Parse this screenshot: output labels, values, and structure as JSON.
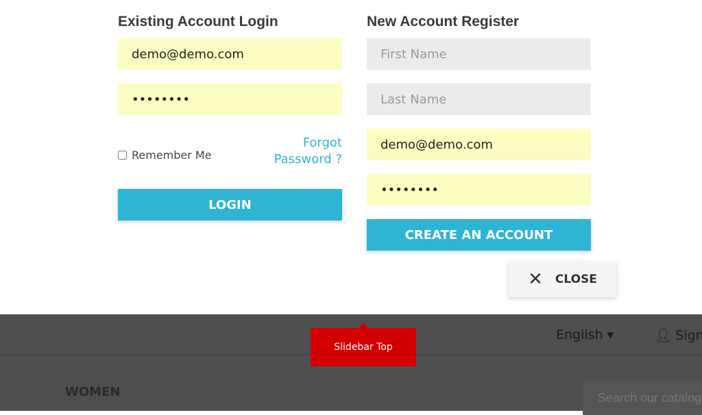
{
  "login": {
    "title": "Existing Account Login",
    "email": "demo@demo.com",
    "password": "demopass",
    "remember_label": "Remember Me",
    "forgot_label": "Forgot Password ?",
    "button": "LOGIN"
  },
  "register": {
    "title": "New Account Register",
    "first_name_placeholder": "First Name",
    "last_name_placeholder": "Last Name",
    "email": "demo@demo.com",
    "password": "demopass",
    "button": "CREATE AN ACCOUNT"
  },
  "close_label": "CLOSE",
  "header": {
    "language": "English ▾",
    "sign_in": "Sign in",
    "tooltip": "Slidebar Top",
    "menu_women": "WOMEN",
    "search_placeholder": "Search our catalog"
  },
  "colors": {
    "accent": "#2fb5d4",
    "autofill": "#fbfdc1",
    "tooltip": "#d40000"
  }
}
